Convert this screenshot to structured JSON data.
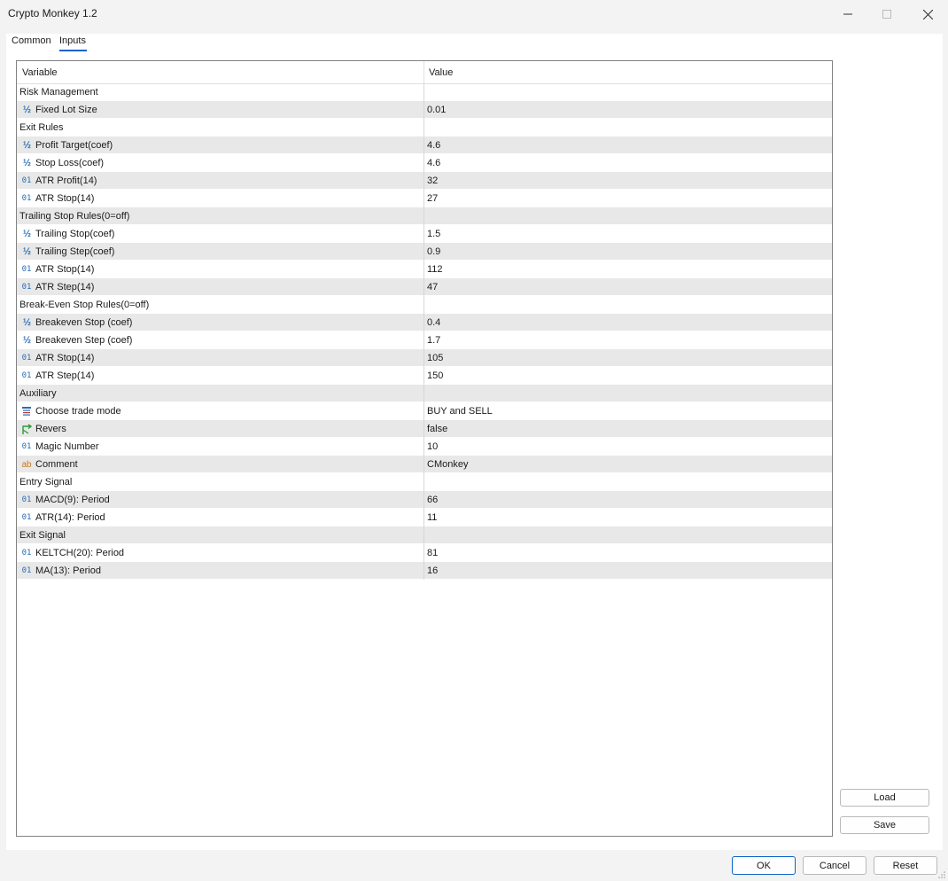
{
  "window": {
    "title": "Crypto Monkey 1.2",
    "controls": [
      "minimize",
      "maximize",
      "close"
    ]
  },
  "tabs": [
    {
      "label": "Common",
      "active": false
    },
    {
      "label": "Inputs",
      "active": true
    }
  ],
  "table": {
    "columns": [
      "Variable",
      "Value"
    ],
    "rows": [
      {
        "type": "group",
        "name": "Risk Management",
        "value": ""
      },
      {
        "type": "double",
        "icon": "fraction-icon",
        "name": "Fixed Lot Size",
        "value": "0.01"
      },
      {
        "type": "group",
        "name": "Exit Rules",
        "value": ""
      },
      {
        "type": "double",
        "icon": "fraction-icon",
        "name": "Profit Target(coef)",
        "value": "4.6"
      },
      {
        "type": "double",
        "icon": "fraction-icon",
        "name": "Stop Loss(coef)",
        "value": "4.6"
      },
      {
        "type": "int",
        "icon": "integer-icon",
        "name": "ATR Profit(14)",
        "value": "32"
      },
      {
        "type": "int",
        "icon": "integer-icon",
        "name": "ATR Stop(14)",
        "value": "27"
      },
      {
        "type": "group",
        "name": "Trailing Stop Rules(0=off)",
        "value": ""
      },
      {
        "type": "double",
        "icon": "fraction-icon",
        "name": "Trailing Stop(coef)",
        "value": "1.5"
      },
      {
        "type": "double",
        "icon": "fraction-icon",
        "name": "Trailing Step(coef)",
        "value": "0.9"
      },
      {
        "type": "int",
        "icon": "integer-icon",
        "name": "ATR Stop(14)",
        "value": "112"
      },
      {
        "type": "int",
        "icon": "integer-icon",
        "name": "ATR Step(14)",
        "value": "47"
      },
      {
        "type": "group",
        "name": "Break-Even Stop Rules(0=off)",
        "value": ""
      },
      {
        "type": "double",
        "icon": "fraction-icon",
        "name": "Breakeven Stop (coef)",
        "value": "0.4"
      },
      {
        "type": "double",
        "icon": "fraction-icon",
        "name": "Breakeven Step (coef)",
        "value": "1.7"
      },
      {
        "type": "int",
        "icon": "integer-icon",
        "name": "ATR Stop(14)",
        "value": "105"
      },
      {
        "type": "int",
        "icon": "integer-icon",
        "name": "ATR Step(14)",
        "value": "150"
      },
      {
        "type": "group",
        "name": "Auxiliary",
        "value": ""
      },
      {
        "type": "enum",
        "icon": "enum-list-icon",
        "name": "Choose trade mode",
        "value": "BUY and SELL"
      },
      {
        "type": "bool",
        "icon": "boolean-arrow-icon",
        "name": "Revers",
        "value": "false"
      },
      {
        "type": "int",
        "icon": "integer-icon",
        "name": "Magic Number",
        "value": "10"
      },
      {
        "type": "string",
        "icon": "string-icon",
        "name": "Comment",
        "value": "CMonkey"
      },
      {
        "type": "group",
        "name": "Entry Signal",
        "value": ""
      },
      {
        "type": "int",
        "icon": "integer-icon",
        "name": "MACD(9): Period",
        "value": "66"
      },
      {
        "type": "int",
        "icon": "integer-icon",
        "name": "ATR(14): Period",
        "value": "11"
      },
      {
        "type": "group",
        "name": "Exit Signal",
        "value": ""
      },
      {
        "type": "int",
        "icon": "integer-icon",
        "name": "KELTCH(20): Period",
        "value": "81"
      },
      {
        "type": "int",
        "icon": "integer-icon",
        "name": "MA(13): Period",
        "value": "16"
      }
    ]
  },
  "side_buttons": {
    "load": "Load",
    "save": "Save"
  },
  "footer_buttons": {
    "ok": "OK",
    "cancel": "Cancel",
    "reset": "Reset"
  },
  "icon_glyphs": {
    "fraction": "½",
    "integer": "01",
    "string": "ab"
  },
  "colors": {
    "accent": "#0a64c8",
    "alt_row": "#e8e8e8",
    "icon_blue": "#2a6cb4",
    "icon_green": "#2e9a3c",
    "icon_orange": "#c57a1c"
  }
}
